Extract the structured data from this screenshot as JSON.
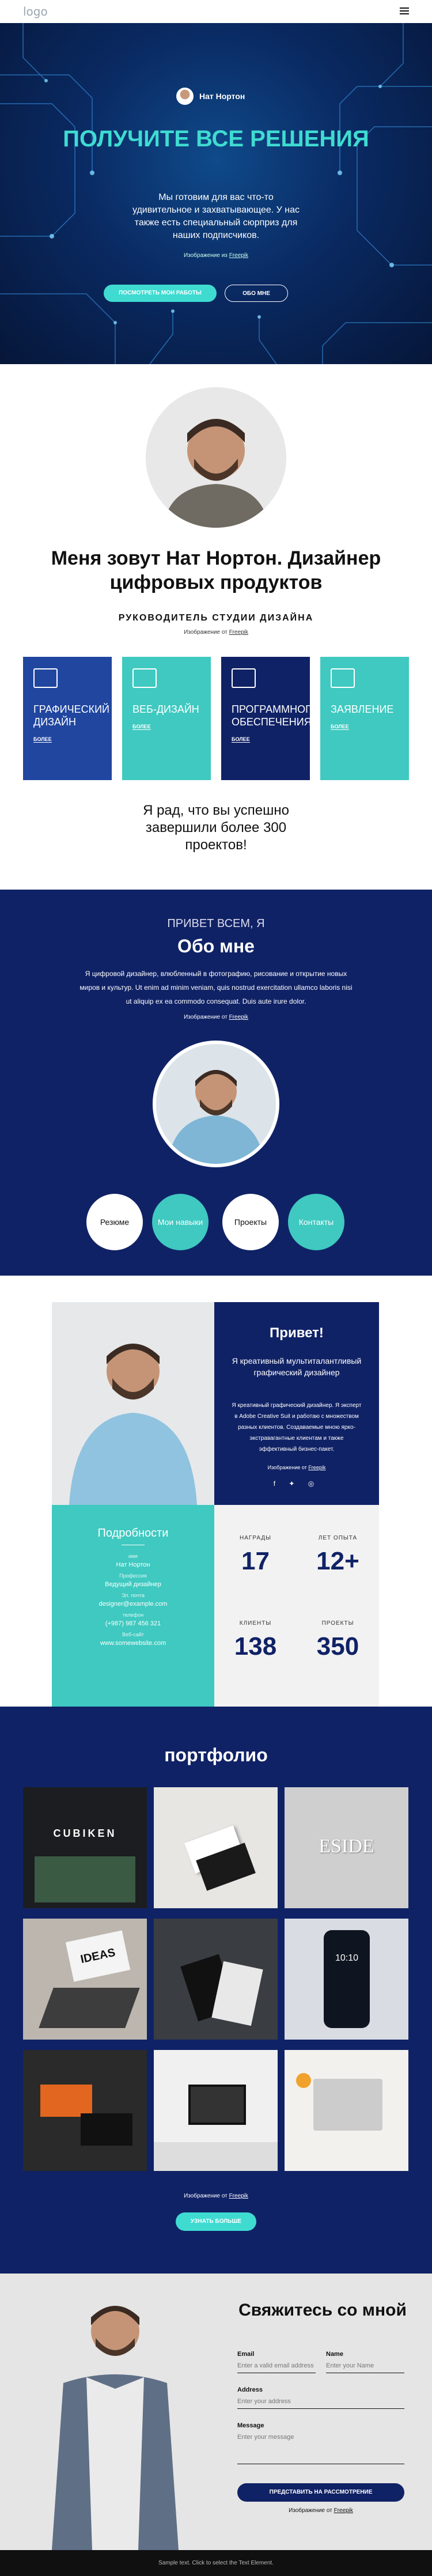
{
  "header": {
    "logo": "logo"
  },
  "hero": {
    "author": "Нат Нортон",
    "title": "ПОЛУЧИТЕ ВСЕ РЕШЕНИЯ",
    "lead": "Мы готовим для вас что-то удивительное и захватывающее. У нас также есть специальный сюрприз для наших подписчиков.",
    "credit_prefix": "Изображение из",
    "credit_link": "Freepik",
    "btn_primary": "ПОСМОТРЕТЬ МОИ РАБОТЫ",
    "btn_secondary": "ОБО МНЕ"
  },
  "intro": {
    "title": "Меня зовут Нат Нортон. Дизайнер цифровых продуктов",
    "role": "РУКОВОДИТЕЛЬ СТУДИИ ДИЗАЙНА",
    "credit_prefix": "Изображение от",
    "credit_link": "Freepik",
    "cards": [
      {
        "title": "ГРАФИЧЕСКИЙ ДИЗАЙН",
        "more": "БОЛЕЕ",
        "color": "#2046a0"
      },
      {
        "title": "ВЕБ-ДИЗАЙН",
        "more": "БОЛЕЕ",
        "color": "#3fc9c0"
      },
      {
        "title": "ПРОГРАММНОГО ОБЕСПЕЧЕНИЯ",
        "more": "БОЛЕЕ",
        "color": "#102266"
      },
      {
        "title": "ЗАЯВЛЕНИЕ",
        "more": "БОЛЕЕ",
        "color": "#3fc9c0"
      }
    ],
    "stat": "Я рад, что вы успешно завершили более 300 проектов!"
  },
  "about": {
    "hello": "ПРИВЕТ ВСЕМ, Я",
    "title": "Обо мне",
    "text": "Я цифровой дизайнер, влюбленный в фотографию, рисование и открытие новых миров и культур. Ut enim ad minim veniam, quis nostrud exercitation ullamco laboris nisi ut aliquip ex ea commodo consequat. Duis aute irure dolor.",
    "credit_prefix": "Изображение от",
    "credit_link": "Freepik",
    "circles": [
      {
        "label": "Резюме",
        "color": "#ffffff",
        "text_color": "#111"
      },
      {
        "label": "Мои навыки",
        "color": "#3fc9c0",
        "text_color": "#ffffff"
      },
      {
        "label": "Проекты",
        "color": "#ffffff",
        "text_color": "#111"
      },
      {
        "label": "Контакты",
        "color": "#3fc9c0",
        "text_color": "#ffffff"
      }
    ]
  },
  "profile": {
    "hi": "Привет!",
    "p1": "Я креативный мультиталантливый графический дизайнер",
    "p2": "Я креативный графический дизайнер. Я эксперт в Adobe Creative Suit и работаю с множеством разных клиентов. Создаваемые мною ярко-экстравагантные клиентам и также эффективный бизнес-пакет.",
    "credit_prefix": "Изображение от",
    "credit_link": "Freepik",
    "social": "f ✦ ◎",
    "details_title": "Подробности",
    "details": [
      {
        "k": "имя",
        "v": "Нат Нортон"
      },
      {
        "k": "Профессия",
        "v": "Ведущий дизайнер"
      },
      {
        "k": "Эл. почта",
        "v": "designer@example.com"
      },
      {
        "k": "телефон",
        "v": "(+987) 987 456 321"
      },
      {
        "k": "Веб-сайт",
        "v": "www.somewebsite.com"
      }
    ],
    "numbers": [
      {
        "label": "НАГРАДЫ",
        "value": "17"
      },
      {
        "label": "ЛЕТ ОПЫТА",
        "value": "12+"
      },
      {
        "label": "КЛИЕНТЫ",
        "value": "138"
      },
      {
        "label": "ПРОЕКТЫ",
        "value": "350"
      }
    ]
  },
  "portfolio": {
    "title": "портфолио",
    "tiles": [
      {
        "name": "cubiken-store",
        "text": "CUBIKEN"
      },
      {
        "name": "business-cards-white",
        "text": ""
      },
      {
        "name": "eside-sign",
        "text": "ESIDE"
      },
      {
        "name": "ideas-laptop",
        "text": "IDEAS"
      },
      {
        "name": "dark-cards",
        "text": ""
      },
      {
        "name": "phone-mockup",
        "text": "10:10"
      },
      {
        "name": "orange-cards",
        "text": ""
      },
      {
        "name": "desk-monitor",
        "text": ""
      },
      {
        "name": "laptop-top-view",
        "text": ""
      }
    ],
    "credit_prefix": "Изображение от",
    "credit_link": "Freepik",
    "button": "УЗНАТЬ БОЛЬШЕ"
  },
  "contact": {
    "title": "Свяжитесь со мной",
    "email_label": "Email",
    "email_placeholder": "Enter a valid email address",
    "name_label": "Name",
    "name_placeholder": "Enter your Name",
    "address_label": "Address",
    "address_placeholder": "Enter your address",
    "message_label": "Message",
    "message_placeholder": "Enter your message",
    "submit": "ПРЕДСТАВИТЬ НА РАССМОТРЕНИЕ",
    "credit_prefix": "Изображение от",
    "credit_link": "Freepik"
  },
  "footer": {
    "text": "Sample text. Click to select the Text Element."
  }
}
